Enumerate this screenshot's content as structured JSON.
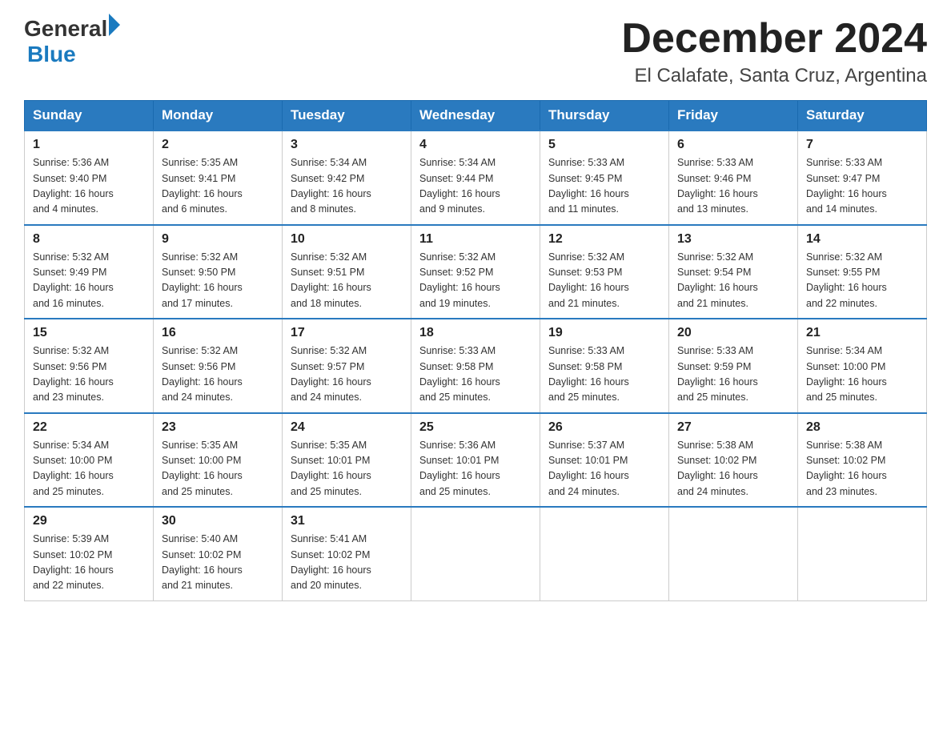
{
  "logo": {
    "general": "General",
    "blue": "Blue"
  },
  "title": "December 2024",
  "subtitle": "El Calafate, Santa Cruz, Argentina",
  "days_of_week": [
    "Sunday",
    "Monday",
    "Tuesday",
    "Wednesday",
    "Thursday",
    "Friday",
    "Saturday"
  ],
  "weeks": [
    [
      {
        "day": "1",
        "info": "Sunrise: 5:36 AM\nSunset: 9:40 PM\nDaylight: 16 hours\nand 4 minutes."
      },
      {
        "day": "2",
        "info": "Sunrise: 5:35 AM\nSunset: 9:41 PM\nDaylight: 16 hours\nand 6 minutes."
      },
      {
        "day": "3",
        "info": "Sunrise: 5:34 AM\nSunset: 9:42 PM\nDaylight: 16 hours\nand 8 minutes."
      },
      {
        "day": "4",
        "info": "Sunrise: 5:34 AM\nSunset: 9:44 PM\nDaylight: 16 hours\nand 9 minutes."
      },
      {
        "day": "5",
        "info": "Sunrise: 5:33 AM\nSunset: 9:45 PM\nDaylight: 16 hours\nand 11 minutes."
      },
      {
        "day": "6",
        "info": "Sunrise: 5:33 AM\nSunset: 9:46 PM\nDaylight: 16 hours\nand 13 minutes."
      },
      {
        "day": "7",
        "info": "Sunrise: 5:33 AM\nSunset: 9:47 PM\nDaylight: 16 hours\nand 14 minutes."
      }
    ],
    [
      {
        "day": "8",
        "info": "Sunrise: 5:32 AM\nSunset: 9:49 PM\nDaylight: 16 hours\nand 16 minutes."
      },
      {
        "day": "9",
        "info": "Sunrise: 5:32 AM\nSunset: 9:50 PM\nDaylight: 16 hours\nand 17 minutes."
      },
      {
        "day": "10",
        "info": "Sunrise: 5:32 AM\nSunset: 9:51 PM\nDaylight: 16 hours\nand 18 minutes."
      },
      {
        "day": "11",
        "info": "Sunrise: 5:32 AM\nSunset: 9:52 PM\nDaylight: 16 hours\nand 19 minutes."
      },
      {
        "day": "12",
        "info": "Sunrise: 5:32 AM\nSunset: 9:53 PM\nDaylight: 16 hours\nand 21 minutes."
      },
      {
        "day": "13",
        "info": "Sunrise: 5:32 AM\nSunset: 9:54 PM\nDaylight: 16 hours\nand 21 minutes."
      },
      {
        "day": "14",
        "info": "Sunrise: 5:32 AM\nSunset: 9:55 PM\nDaylight: 16 hours\nand 22 minutes."
      }
    ],
    [
      {
        "day": "15",
        "info": "Sunrise: 5:32 AM\nSunset: 9:56 PM\nDaylight: 16 hours\nand 23 minutes."
      },
      {
        "day": "16",
        "info": "Sunrise: 5:32 AM\nSunset: 9:56 PM\nDaylight: 16 hours\nand 24 minutes."
      },
      {
        "day": "17",
        "info": "Sunrise: 5:32 AM\nSunset: 9:57 PM\nDaylight: 16 hours\nand 24 minutes."
      },
      {
        "day": "18",
        "info": "Sunrise: 5:33 AM\nSunset: 9:58 PM\nDaylight: 16 hours\nand 25 minutes."
      },
      {
        "day": "19",
        "info": "Sunrise: 5:33 AM\nSunset: 9:58 PM\nDaylight: 16 hours\nand 25 minutes."
      },
      {
        "day": "20",
        "info": "Sunrise: 5:33 AM\nSunset: 9:59 PM\nDaylight: 16 hours\nand 25 minutes."
      },
      {
        "day": "21",
        "info": "Sunrise: 5:34 AM\nSunset: 10:00 PM\nDaylight: 16 hours\nand 25 minutes."
      }
    ],
    [
      {
        "day": "22",
        "info": "Sunrise: 5:34 AM\nSunset: 10:00 PM\nDaylight: 16 hours\nand 25 minutes."
      },
      {
        "day": "23",
        "info": "Sunrise: 5:35 AM\nSunset: 10:00 PM\nDaylight: 16 hours\nand 25 minutes."
      },
      {
        "day": "24",
        "info": "Sunrise: 5:35 AM\nSunset: 10:01 PM\nDaylight: 16 hours\nand 25 minutes."
      },
      {
        "day": "25",
        "info": "Sunrise: 5:36 AM\nSunset: 10:01 PM\nDaylight: 16 hours\nand 25 minutes."
      },
      {
        "day": "26",
        "info": "Sunrise: 5:37 AM\nSunset: 10:01 PM\nDaylight: 16 hours\nand 24 minutes."
      },
      {
        "day": "27",
        "info": "Sunrise: 5:38 AM\nSunset: 10:02 PM\nDaylight: 16 hours\nand 24 minutes."
      },
      {
        "day": "28",
        "info": "Sunrise: 5:38 AM\nSunset: 10:02 PM\nDaylight: 16 hours\nand 23 minutes."
      }
    ],
    [
      {
        "day": "29",
        "info": "Sunrise: 5:39 AM\nSunset: 10:02 PM\nDaylight: 16 hours\nand 22 minutes."
      },
      {
        "day": "30",
        "info": "Sunrise: 5:40 AM\nSunset: 10:02 PM\nDaylight: 16 hours\nand 21 minutes."
      },
      {
        "day": "31",
        "info": "Sunrise: 5:41 AM\nSunset: 10:02 PM\nDaylight: 16 hours\nand 20 minutes."
      },
      {
        "day": "",
        "info": ""
      },
      {
        "day": "",
        "info": ""
      },
      {
        "day": "",
        "info": ""
      },
      {
        "day": "",
        "info": ""
      }
    ]
  ]
}
